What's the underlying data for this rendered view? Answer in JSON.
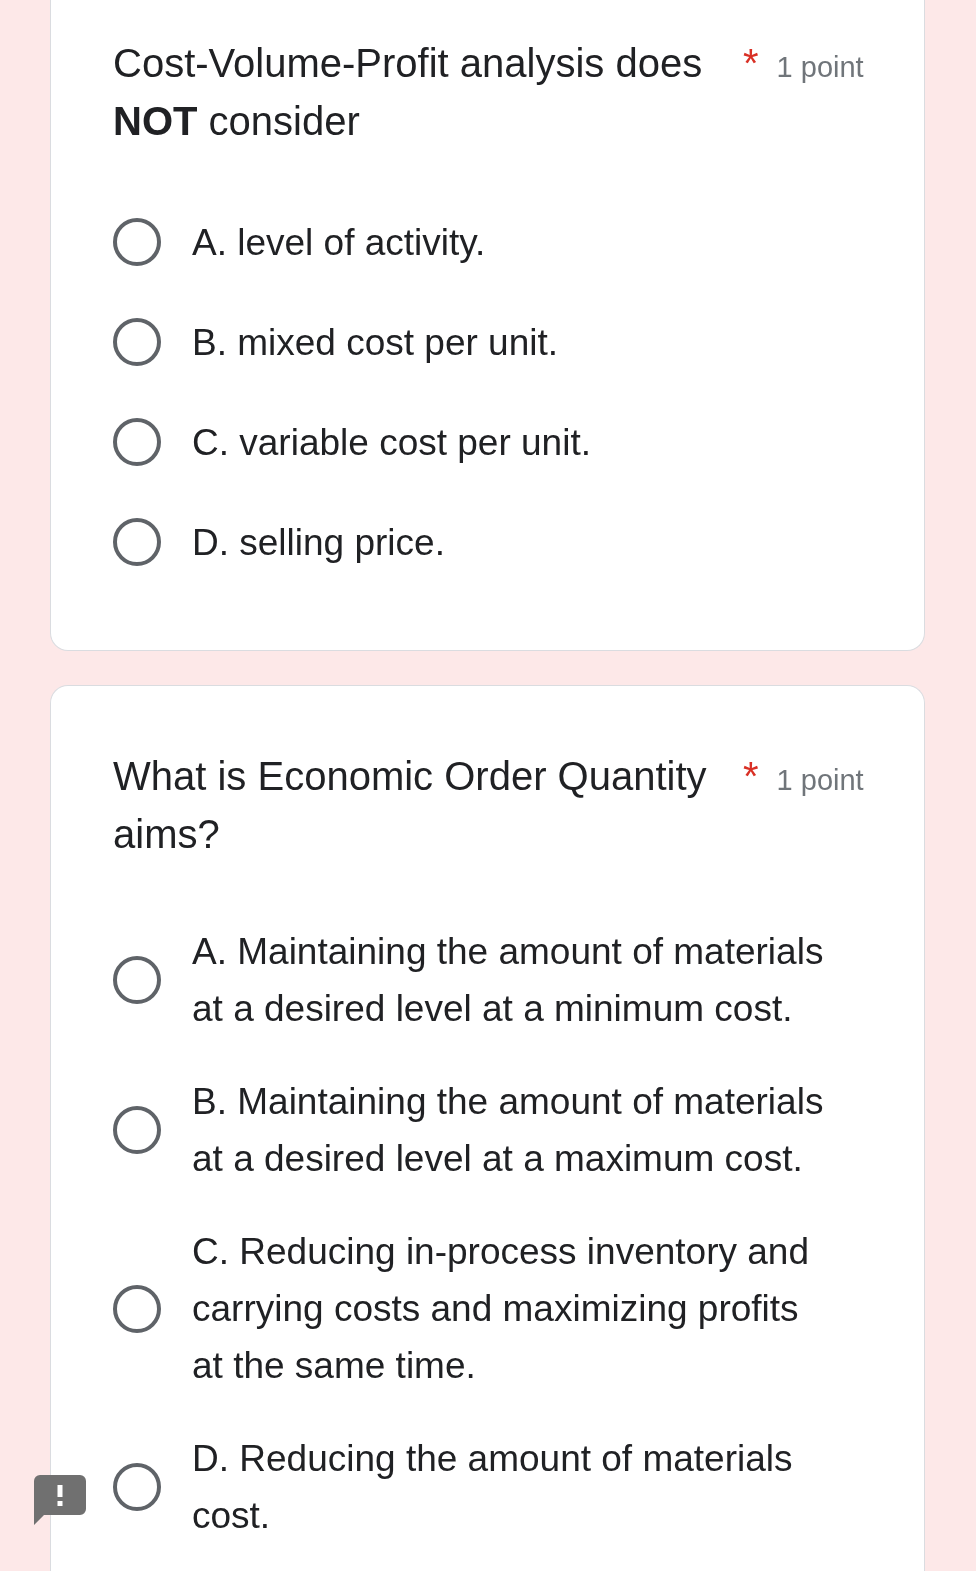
{
  "questions": [
    {
      "title": "Cost-Volume-Profit analysis does **NOT** consider",
      "required_mark": "*",
      "points": "1 point",
      "options": [
        {
          "label": "A. level of activity.",
          "selected": false
        },
        {
          "label": "B. mixed cost per unit.",
          "selected": false
        },
        {
          "label": "C. variable cost per unit.",
          "selected": false
        },
        {
          "label": "D. selling price.",
          "selected": false
        }
      ]
    },
    {
      "title": "What is Economic Order Quantity aims?",
      "required_mark": "*",
      "points": "1 point",
      "options": [
        {
          "label": "A. Maintaining the amount of materials\nat a desired level at a minimum cost.",
          "selected": false
        },
        {
          "label": "B. Maintaining the amount of materials\nat a desired level at a maximum cost.",
          "selected": false
        },
        {
          "label": "C. Reducing in-process inventory and\ncarrying costs and maximizing profits\nat the same time.",
          "selected": false
        },
        {
          "label": "D. Reducing the amount of materials\ncost.",
          "selected": false
        }
      ]
    }
  ]
}
